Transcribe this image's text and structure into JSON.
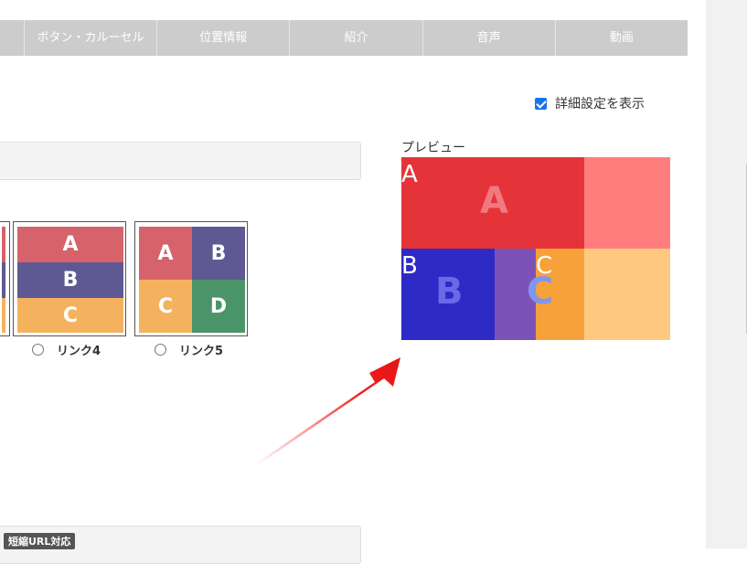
{
  "tabs": [
    "",
    "ボタン・カルーセル",
    "位置情報",
    "紹介",
    "音声",
    "動画"
  ],
  "advanced": {
    "label": "詳細設定を表示",
    "checked": true
  },
  "preview": {
    "label": "プレビュー",
    "regions": [
      "A",
      "B",
      "C"
    ],
    "colors": {
      "a": "#e5333a",
      "a_light": "#ff7d7d",
      "b": "#2e2ac6",
      "b_mid": "#7c52b9",
      "c": "#f7a13a",
      "c_light": "#ffc880"
    }
  },
  "layouts": [
    {
      "label": "リンク4",
      "cells": [
        "A",
        "B",
        "C"
      ],
      "colors": [
        "#d6636b",
        "#5e5993",
        "#f5b25e"
      ]
    },
    {
      "label": "リンク5",
      "cells": [
        "A",
        "B",
        "C",
        "D"
      ],
      "colors": [
        "#d6636b",
        "#5e5993",
        "#f5b25e",
        "#4a946a"
      ]
    }
  ],
  "badge": "短縮URL対応"
}
